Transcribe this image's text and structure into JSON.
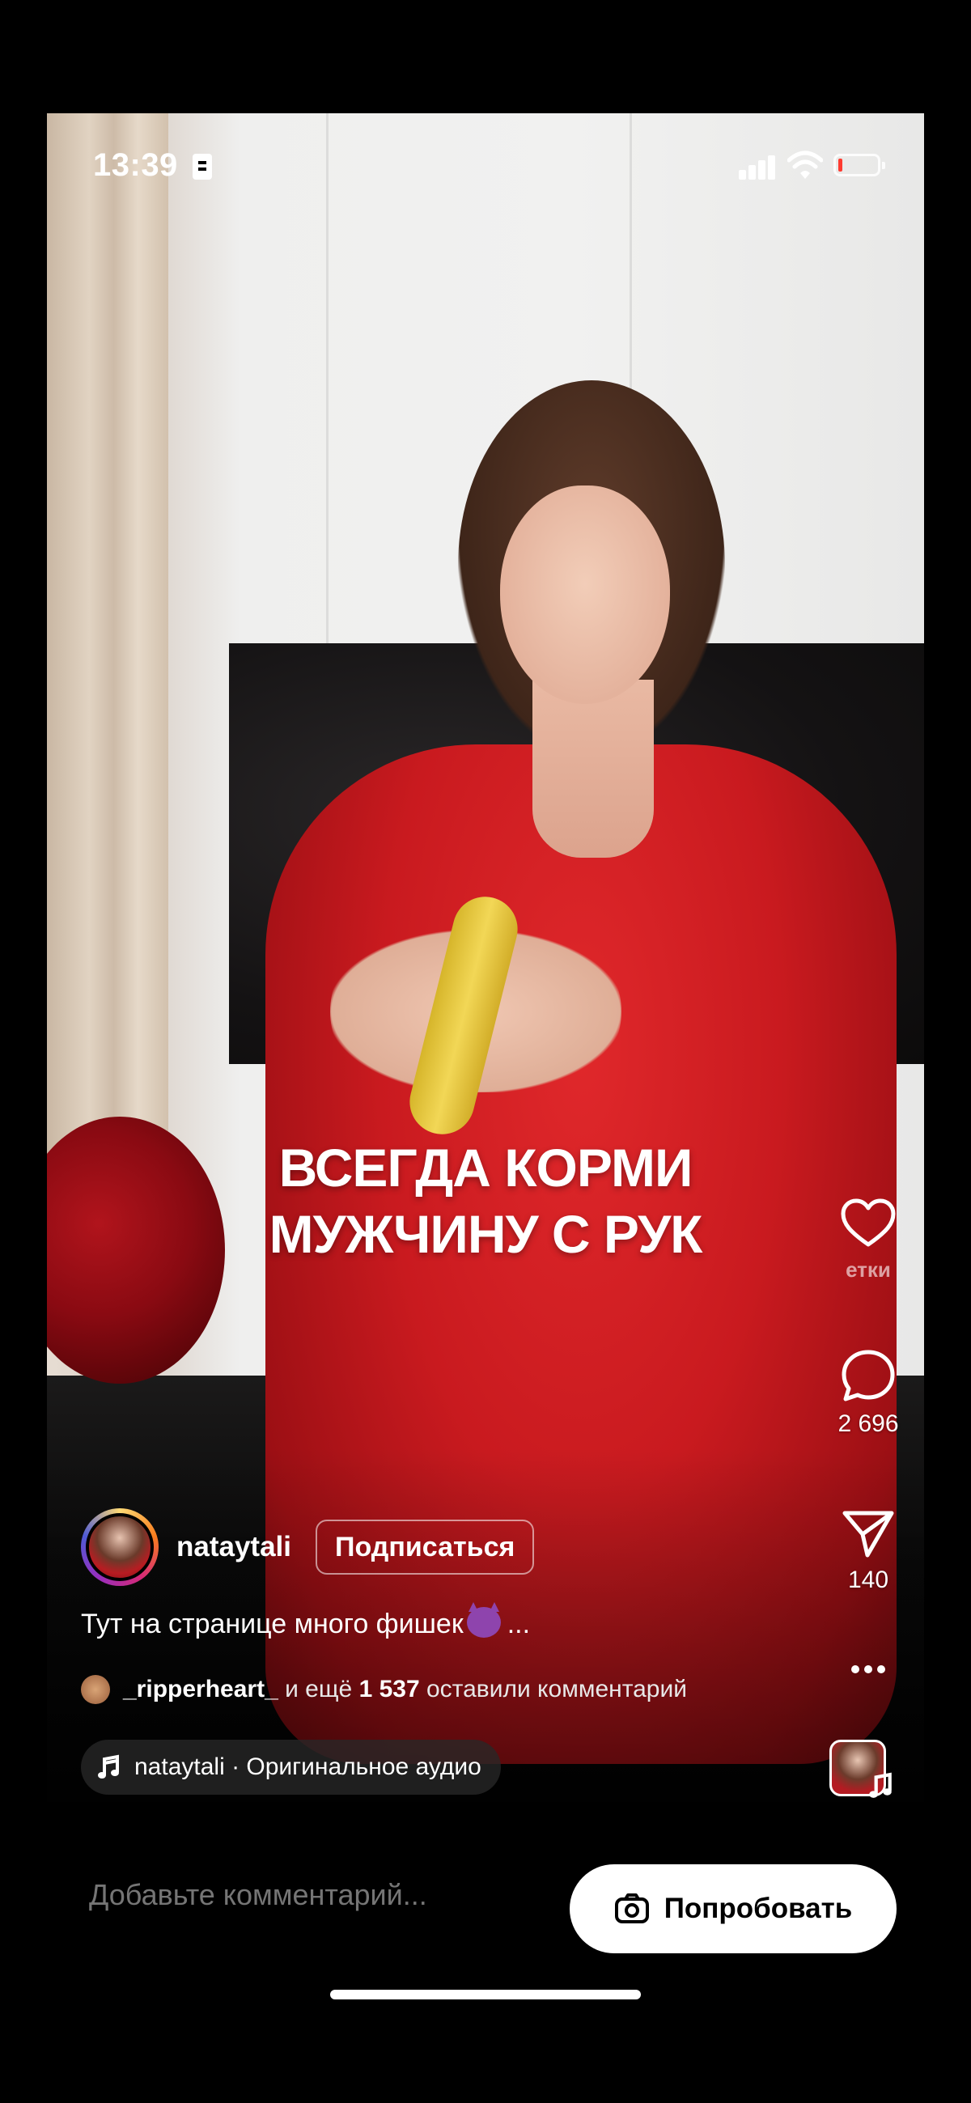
{
  "status_bar": {
    "time": "13:39",
    "battery_level": 0.1,
    "battery_color": "#ff3b30"
  },
  "video": {
    "overlay_line1": "ВСЕГДА КОРМИ",
    "overlay_line2": "МУЖЧИНУ С РУК",
    "progress": 0.05
  },
  "actions": {
    "like_label": "етки",
    "comments_count": "2 696",
    "shares_count": "140",
    "more_icon": "more-dots-icon"
  },
  "author": {
    "username": "nataytali",
    "follow_label": "Подписаться"
  },
  "caption": {
    "text": "Тут на странице много фишек",
    "emoji": "devil-emoji",
    "more": "..."
  },
  "comments_preview": {
    "user": "_ripperheart_",
    "middle": " и ещё ",
    "count": "1 537",
    "suffix": " оставили комментарий"
  },
  "audio": {
    "label": "nataytali · Оригинальное аудио"
  },
  "bottom_bar": {
    "comment_placeholder": "Добавьте комментарий...",
    "try_label": "Попробовать"
  }
}
